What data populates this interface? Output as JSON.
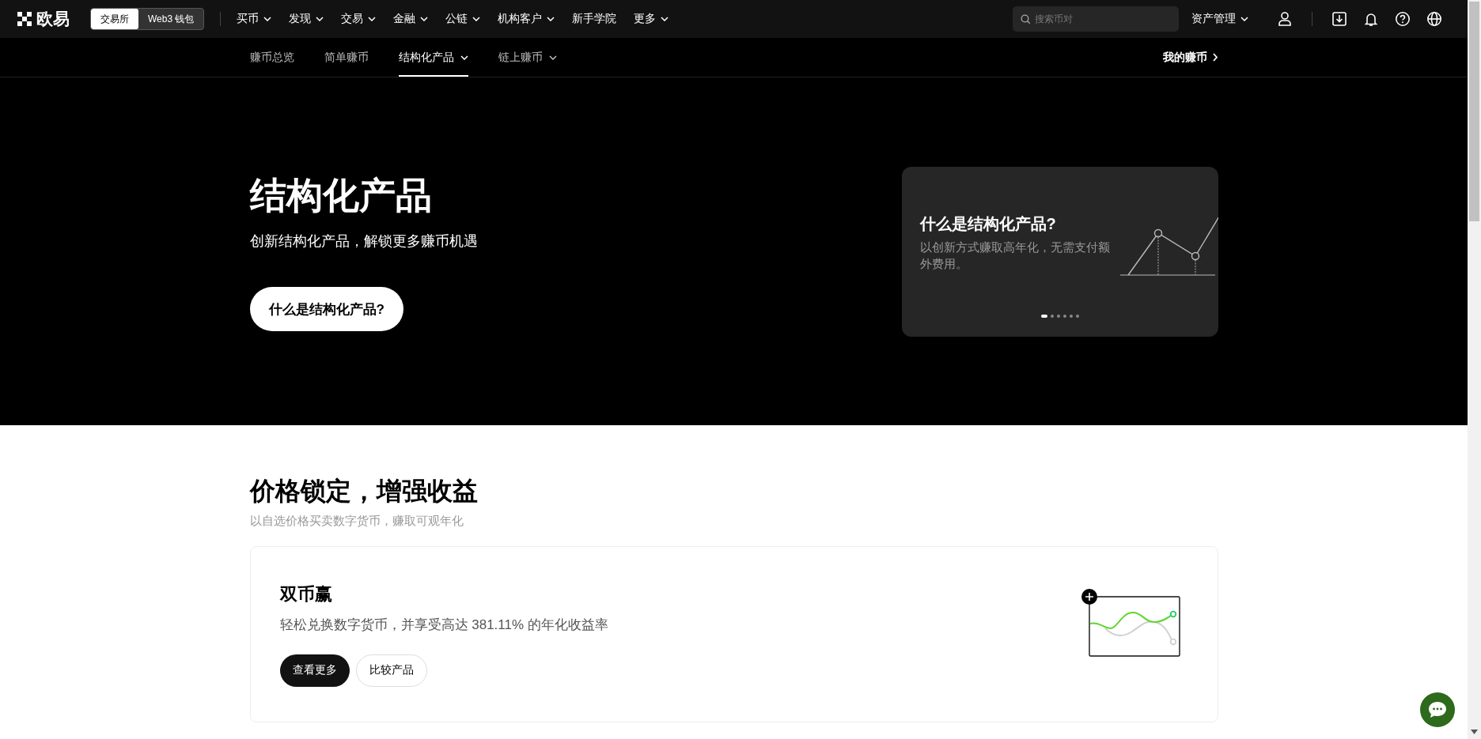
{
  "header": {
    "logo": "欧易",
    "mode_switch": [
      {
        "label": "交易所",
        "selected": true
      },
      {
        "label": "Web3 钱包",
        "selected": false
      }
    ],
    "menu": [
      {
        "label": "买币",
        "dropdown": true
      },
      {
        "label": "发现",
        "dropdown": true
      },
      {
        "label": "交易",
        "dropdown": true
      },
      {
        "label": "金融",
        "dropdown": true
      },
      {
        "label": "公链",
        "dropdown": true
      },
      {
        "label": "机构客户",
        "dropdown": true
      },
      {
        "label": "新手学院",
        "dropdown": false
      },
      {
        "label": "更多",
        "dropdown": true
      }
    ],
    "search": {
      "placeholder": "搜索币对"
    },
    "asset_menu": {
      "label": "资产管理"
    }
  },
  "subnav": {
    "tabs": [
      {
        "label": "赚币总览",
        "selected": false,
        "dropdown": false
      },
      {
        "label": "简单赚币",
        "selected": false,
        "dropdown": false
      },
      {
        "label": "结构化产品",
        "selected": true,
        "dropdown": true
      },
      {
        "label": "链上赚币",
        "selected": false,
        "dropdown": true
      }
    ],
    "my_earn": "我的赚币"
  },
  "hero": {
    "title": "结构化产品",
    "subtitle": "创新结构化产品，解锁更多赚币机遇",
    "button": "什么是结构化产品?",
    "card": {
      "title": "什么是结构化产品?",
      "text": "以创新方式赚取高年化，无需支付额外费用。",
      "dots": [
        {
          "selected": true
        },
        {
          "selected": false
        },
        {
          "selected": false
        },
        {
          "selected": false
        },
        {
          "selected": false
        },
        {
          "selected": false
        }
      ]
    }
  },
  "section": {
    "title": "价格锁定，增强收益",
    "subtitle": "以自选价格买卖数字货币，赚取可观年化",
    "products": [
      {
        "name": "双币赢",
        "description": "轻松兑换数字货币，并享受高达 381.11% 的年化收益率",
        "buttons": [
          {
            "label": "查看更多",
            "kind": "primary"
          },
          {
            "label": "比较产品",
            "kind": "secondary"
          }
        ]
      }
    ]
  }
}
